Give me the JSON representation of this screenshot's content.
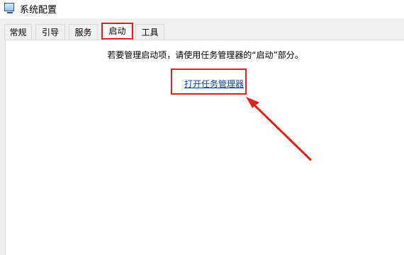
{
  "window": {
    "title": "系统配置"
  },
  "tabs": [
    {
      "label": "常规"
    },
    {
      "label": "引导"
    },
    {
      "label": "服务"
    },
    {
      "label": "启动"
    },
    {
      "label": "工具"
    }
  ],
  "active_tab": "启动",
  "startup": {
    "info_text": "若要管理启动项，请使用任务管理器的“启动”部分。",
    "open_task_manager_link": "打开任务管理器"
  },
  "annotation_color": "#e0211c"
}
